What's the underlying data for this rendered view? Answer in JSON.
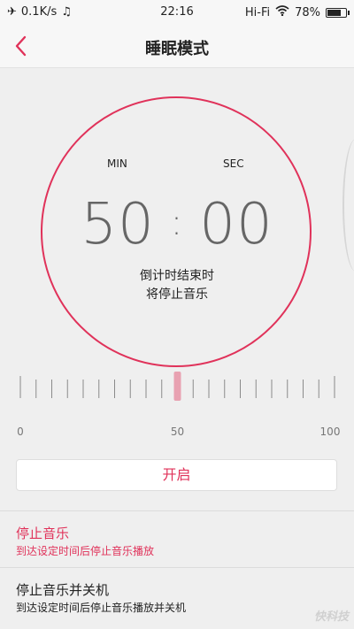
{
  "status_bar": {
    "network_speed": "0.1K/s",
    "time": "22:16",
    "connection": "Hi-Fi",
    "battery": "78%",
    "battery_level": 0.78
  },
  "nav": {
    "title": "睡眠模式",
    "back_icon": "chevron-left-icon"
  },
  "timer": {
    "min_label": "MIN",
    "sec_label": "SEC",
    "minutes": "50",
    "separator": ":",
    "seconds": "00",
    "desc_line1": "倒计时结束时",
    "desc_line2": "将停止音乐"
  },
  "slider": {
    "min_label": "0",
    "mid_label": "50",
    "max_label": "100",
    "min": 0,
    "max": 100,
    "value": 50,
    "tick_count": 21
  },
  "start_button": {
    "label": "开启"
  },
  "options": [
    {
      "title": "停止音乐",
      "subtitle": "到达设定时间后停止音乐播放",
      "selected": true
    },
    {
      "title": "停止音乐并关机",
      "subtitle": "到达设定时间后停止音乐播放并关机",
      "selected": false
    }
  ],
  "watermark": "快科技",
  "colors": {
    "accent": "#e0325a",
    "background": "#efefef"
  }
}
